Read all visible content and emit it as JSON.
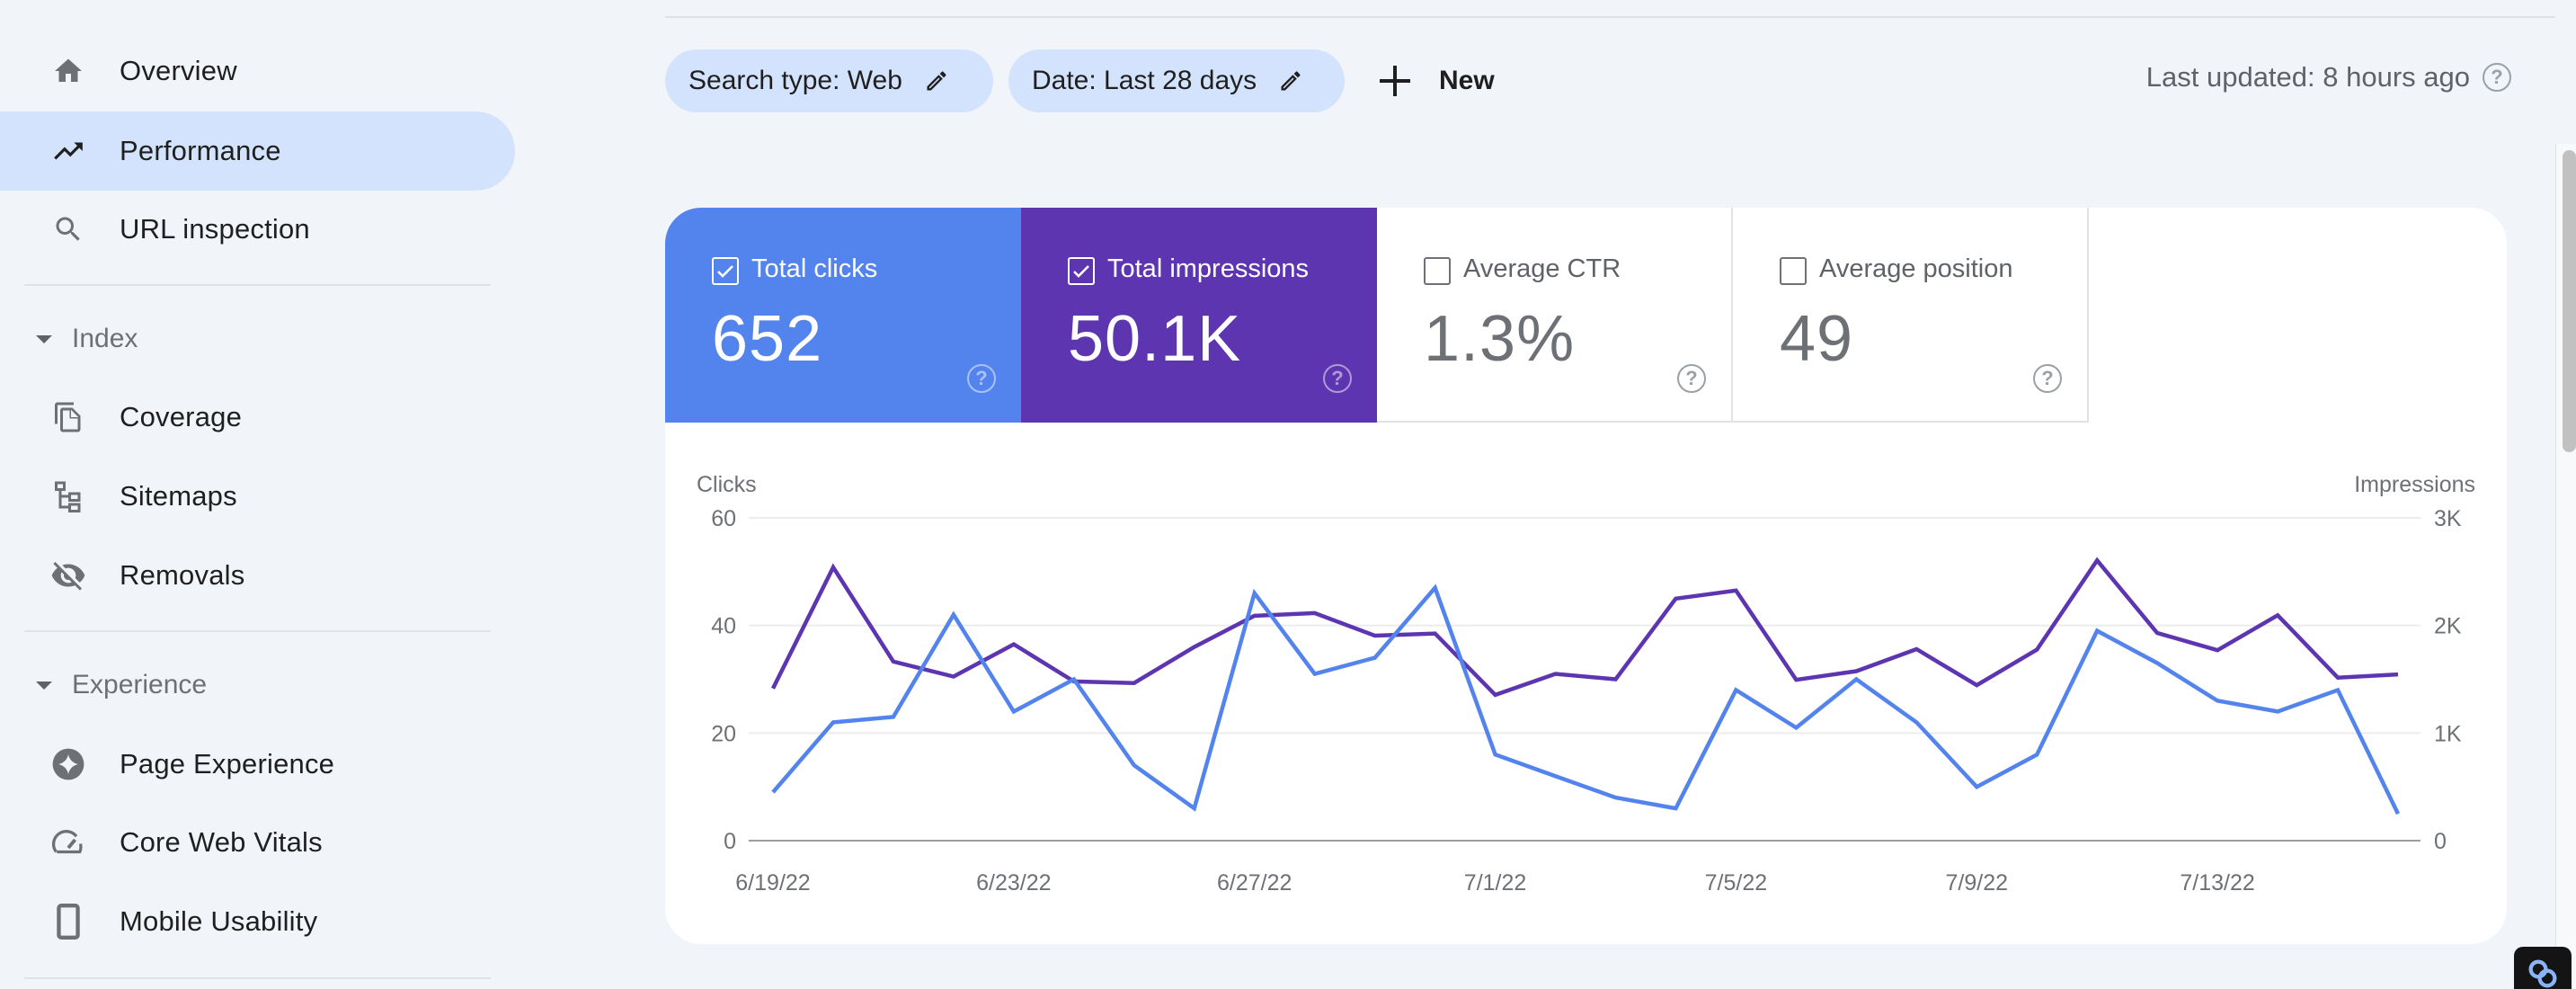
{
  "sidebar": {
    "items": [
      {
        "label": "Overview",
        "icon": "home-icon",
        "active": false
      },
      {
        "label": "Performance",
        "icon": "trending-up-icon",
        "active": true
      },
      {
        "label": "URL inspection",
        "icon": "search-icon",
        "active": false
      }
    ],
    "sections": [
      {
        "title": "Index",
        "items": [
          {
            "label": "Coverage",
            "icon": "file-copy-icon"
          },
          {
            "label": "Sitemaps",
            "icon": "sitemap-icon"
          },
          {
            "label": "Removals",
            "icon": "visibility-off-icon"
          }
        ]
      },
      {
        "title": "Experience",
        "items": [
          {
            "label": "Page Experience",
            "icon": "sparkle-badge-icon"
          },
          {
            "label": "Core Web Vitals",
            "icon": "speed-gauge-icon"
          },
          {
            "label": "Mobile Usability",
            "icon": "smartphone-icon"
          }
        ]
      }
    ]
  },
  "filters": {
    "chips": [
      {
        "label": "Search type: Web",
        "icon": "edit-pencil-icon"
      },
      {
        "label": "Date: Last 28 days",
        "icon": "edit-pencil-icon"
      }
    ],
    "new_label": "New",
    "last_updated": "Last updated: 8 hours ago"
  },
  "metrics": [
    {
      "label": "Total clicks",
      "value": "652",
      "checked": true,
      "color": "#5383ec"
    },
    {
      "label": "Total impressions",
      "value": "50.1K",
      "checked": true,
      "color": "#5e35b1"
    },
    {
      "label": "Average CTR",
      "value": "1.3%",
      "checked": false
    },
    {
      "label": "Average position",
      "value": "49",
      "checked": false
    }
  ],
  "chart_data": {
    "type": "line",
    "title": "",
    "x": [
      "6/19/22",
      "6/20/22",
      "6/21/22",
      "6/22/22",
      "6/23/22",
      "6/24/22",
      "6/25/22",
      "6/26/22",
      "6/27/22",
      "6/28/22",
      "6/29/22",
      "6/30/22",
      "7/1/22",
      "7/2/22",
      "7/3/22",
      "7/4/22",
      "7/5/22",
      "7/6/22",
      "7/7/22",
      "7/8/22",
      "7/9/22",
      "7/10/22",
      "7/11/22",
      "7/12/22",
      "7/13/22",
      "7/14/22",
      "7/15/22",
      "7/16/22"
    ],
    "x_tick_labels": [
      "6/19/22",
      "6/23/22",
      "6/27/22",
      "7/1/22",
      "7/5/22",
      "7/9/22",
      "7/13/22"
    ],
    "series": [
      {
        "name": "Clicks",
        "axis": "left",
        "color": "#5383ec",
        "values": [
          9,
          22,
          23,
          42,
          24,
          30,
          14,
          6,
          46,
          31,
          34,
          47,
          16,
          12,
          8,
          6,
          28,
          21,
          30,
          22,
          10,
          16,
          39,
          33,
          26,
          24,
          28,
          5
        ]
      },
      {
        "name": "Impressions",
        "axis": "right",
        "color": "#5e35b1",
        "values": [
          1415,
          2540,
          1665,
          1525,
          1825,
          1480,
          1465,
          1800,
          2090,
          2115,
          1905,
          1925,
          1355,
          1550,
          1500,
          2250,
          2325,
          1495,
          1575,
          1780,
          1445,
          1775,
          2605,
          1930,
          1770,
          2095,
          1515,
          1545
        ]
      }
    ],
    "ylabel": "Clicks",
    "ylim": [
      0,
      60
    ],
    "y_ticks": [
      "0",
      "20",
      "40",
      "60"
    ],
    "y2label": "Impressions",
    "y2lim": [
      0,
      3000
    ],
    "y2_ticks": [
      "0",
      "1K",
      "2K",
      "3K"
    ],
    "grid": true,
    "legend": "none"
  }
}
